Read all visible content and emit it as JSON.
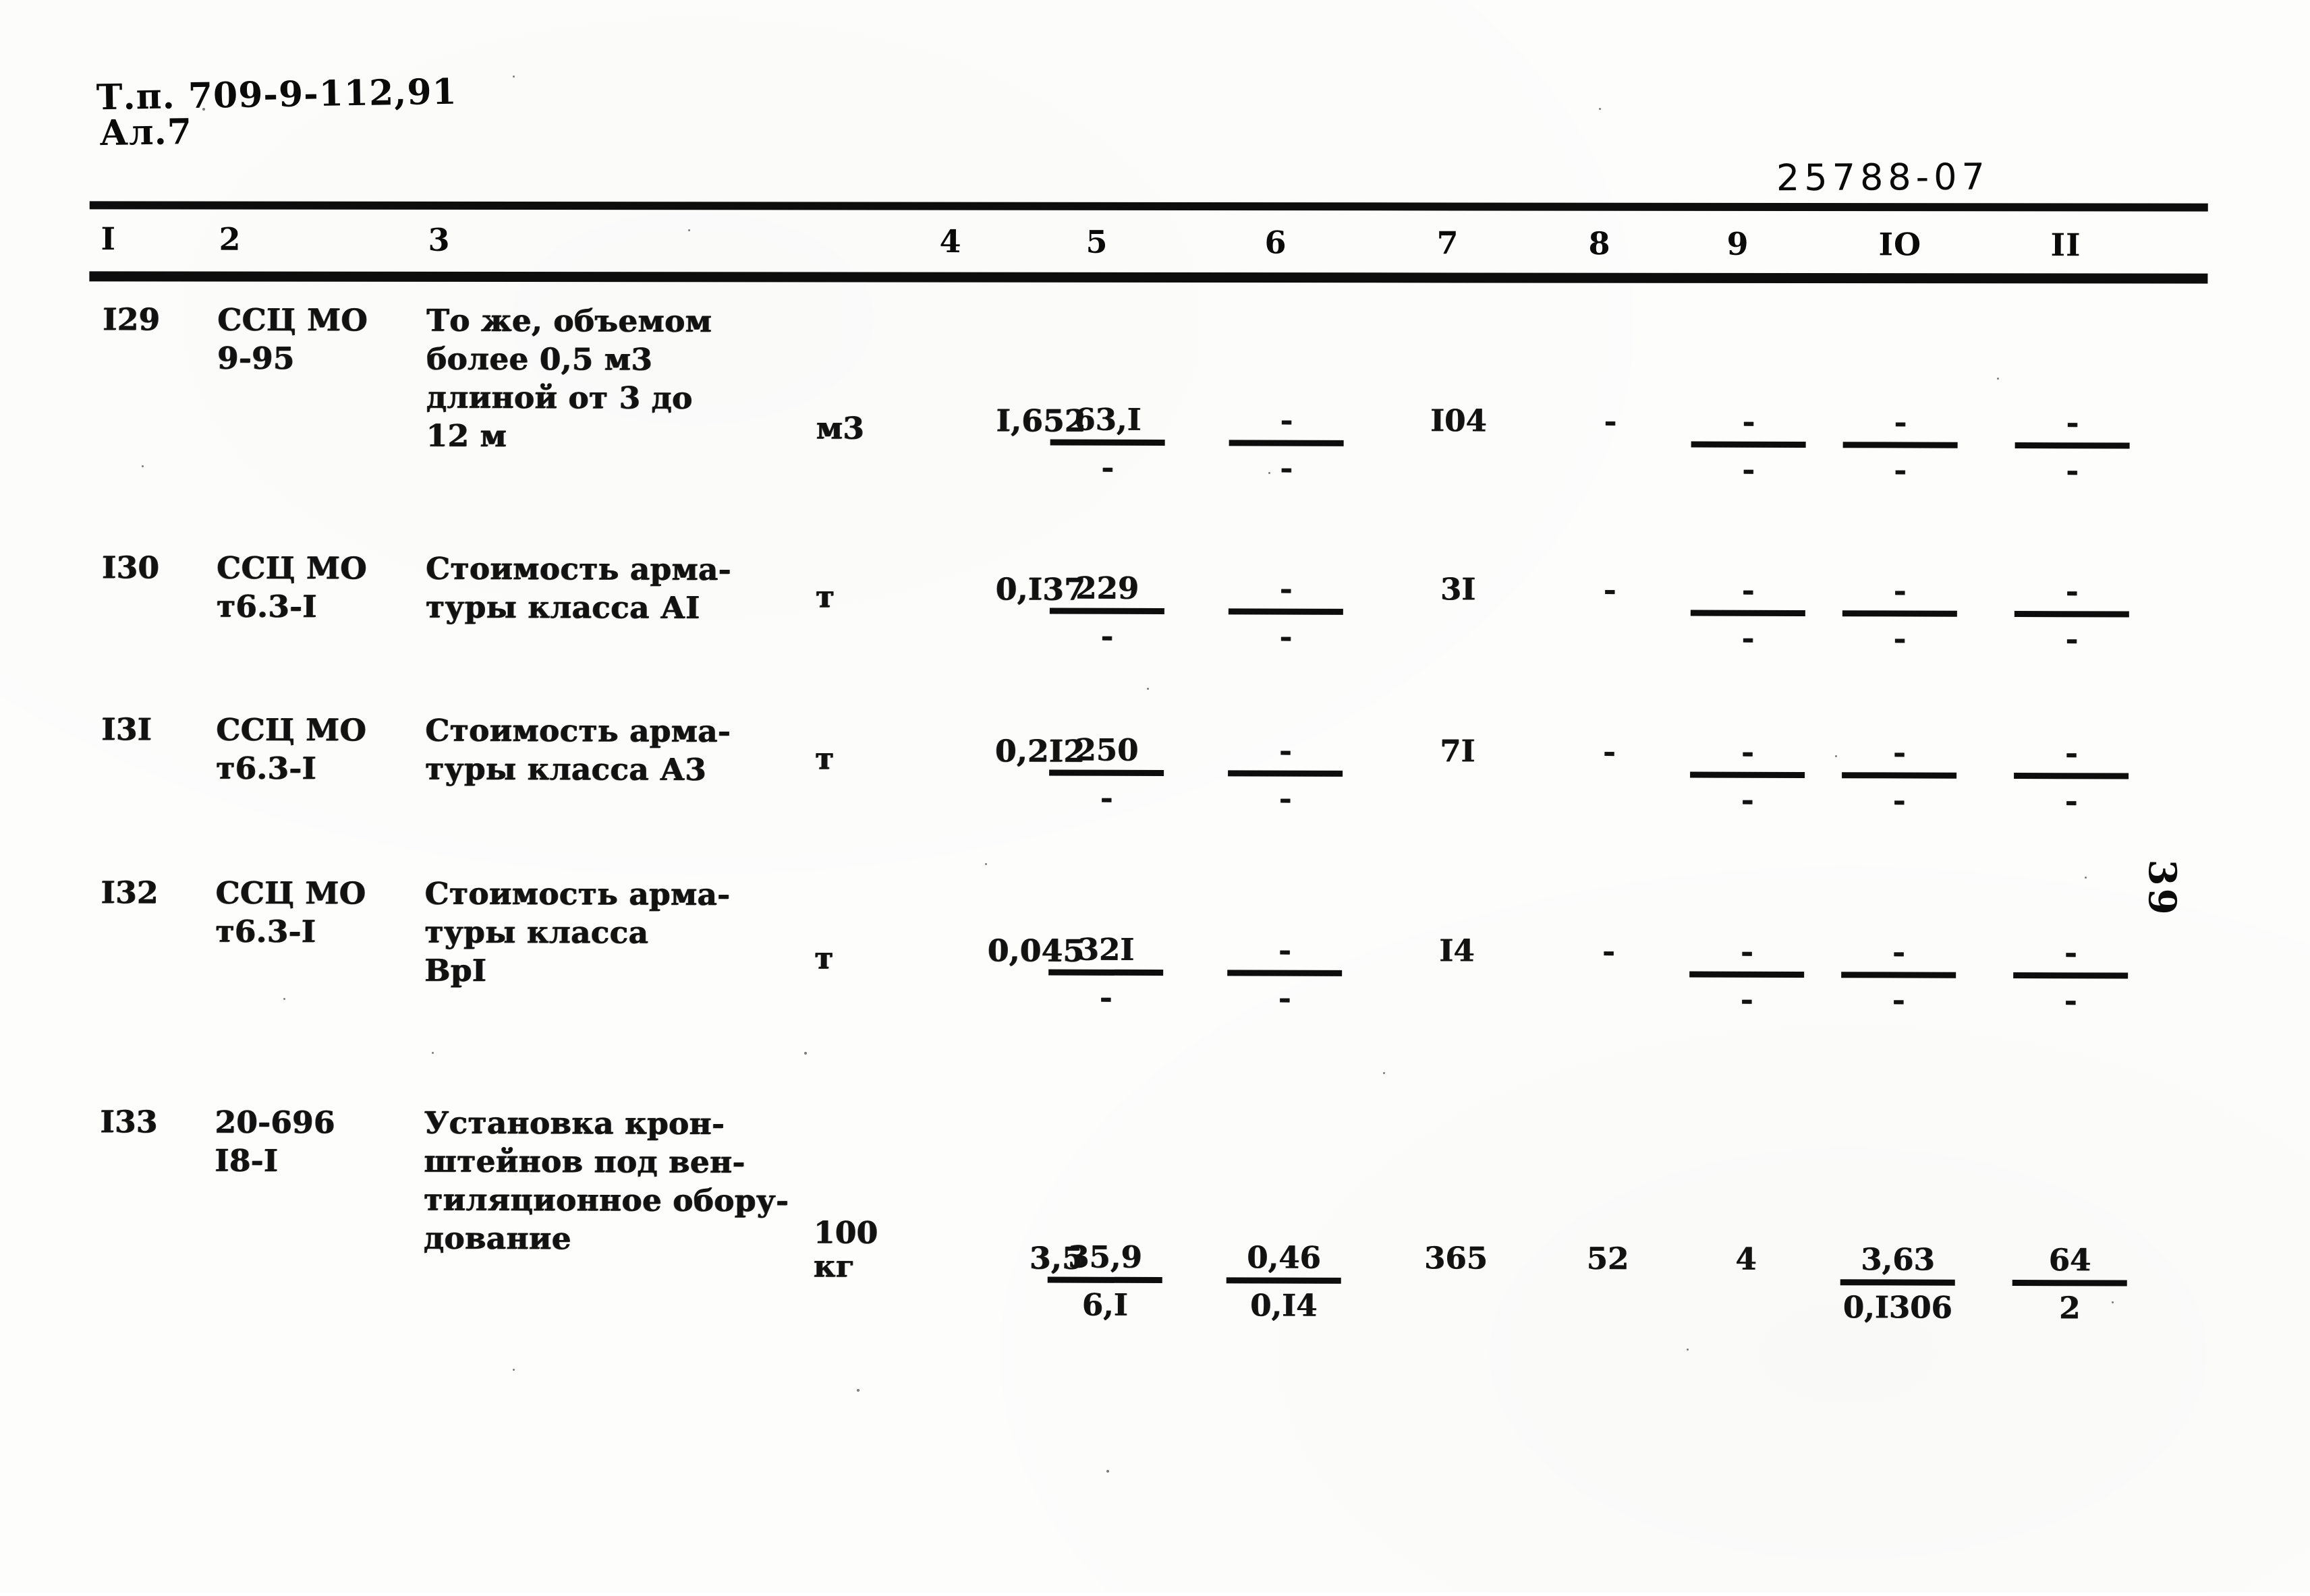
{
  "document": {
    "hand_stamp_line1": "Т.п. 709-9-112,91",
    "hand_stamp_line2": "Ал.7",
    "archive_code": "25788-07",
    "page_number": "39"
  },
  "table": {
    "column_numbers": [
      "I",
      "2",
      "3",
      "4",
      "5",
      "6",
      "7",
      "8",
      "9",
      "IO",
      "II"
    ],
    "rows": [
      {
        "num": "I29",
        "code": "ССЦ МО\n9-95",
        "desc": "То же, объемом\nболее 0,5 м3\nдлиной от 3 до\n12 м",
        "unit": "м3",
        "qty": "I,652",
        "c5_top": "63,I",
        "c5_bot": "-",
        "c6_top": "-",
        "c6_bot": "-",
        "c7": "I04",
        "c8": "-",
        "c9_top": "-",
        "c9_bot": "-",
        "c10_top": "-",
        "c10_bot": "-",
        "c11_top": "-",
        "c11_bot": "-"
      },
      {
        "num": "I30",
        "code": "ССЦ МО\nт6.3-I",
        "desc": "Стоимость арма-\nтуры класса АI",
        "unit": "т",
        "qty": "0,I37",
        "c5_top": "229",
        "c5_bot": "-",
        "c6_top": "-",
        "c6_bot": "-",
        "c7": "3I",
        "c8": "-",
        "c9_top": "-",
        "c9_bot": "-",
        "c10_top": "-",
        "c10_bot": "-",
        "c11_top": "-",
        "c11_bot": "-"
      },
      {
        "num": "I3I",
        "code": "ССЦ МО\nт6.3-I",
        "desc": "Стоимость арма-\nтуры класса А3",
        "unit": "т",
        "qty": "0,2I2",
        "c5_top": "250",
        "c5_bot": "-",
        "c6_top": "-",
        "c6_bot": "-",
        "c7": "7I",
        "c8": "-",
        "c9_top": "-",
        "c9_bot": "-",
        "c10_top": "-",
        "c10_bot": "-",
        "c11_top": "-",
        "c11_bot": "-"
      },
      {
        "num": "I32",
        "code": "ССЦ МО\nт6.3-I",
        "desc": "Стоимость арма-\n  туры класса\n  ВрI",
        "unit": "т",
        "qty": "0,045",
        "c5_top": "32I",
        "c5_bot": "-",
        "c6_top": "-",
        "c6_bot": "-",
        "c7": "I4",
        "c8": "-",
        "c9_top": "-",
        "c9_bot": "-",
        "c10_top": "-",
        "c10_bot": "-",
        "c11_top": "-",
        "c11_bot": "-"
      },
      {
        "num": "I33",
        "code": "20-696\nI8-I",
        "desc": "Установка крон-\nштейнов под вен-\nтиляционное обору-\nдование",
        "unit": "100\nкг",
        "qty": "3,5",
        "c5_top": "35,9",
        "c5_bot": "6,I",
        "c6_top": "0,46",
        "c6_bot": "0,I4",
        "c7": "365",
        "c8": "52",
        "c9_top": "4",
        "c9_bot": "",
        "c10_top": "3,63",
        "c10_bot": "0,I306",
        "c11_top": "64",
        "c11_bot": "2"
      }
    ]
  }
}
